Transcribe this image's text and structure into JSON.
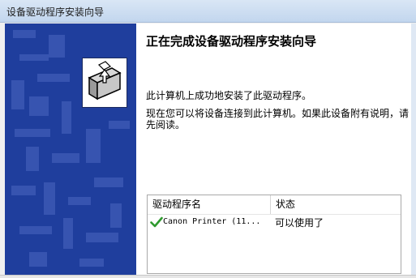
{
  "window": {
    "title": "设备驱动程序安装向导"
  },
  "main": {
    "heading": "正在完成设备驱动程序安装向导",
    "message1": "此计算机上成功地安装了此驱动程序。",
    "message2": "现在您可以将设备连接到此计算机。如果此设备附有说明，请先阅读。"
  },
  "table": {
    "columns": [
      "驱动程序名",
      "状态"
    ],
    "rows": [
      {
        "name": "Canon Printer   (11...",
        "status": "可以使用了",
        "icon": "checkmark-icon"
      }
    ]
  },
  "colors": {
    "sidebar_blue": "#1f3e9d",
    "check_green": "#2f9a2f"
  }
}
